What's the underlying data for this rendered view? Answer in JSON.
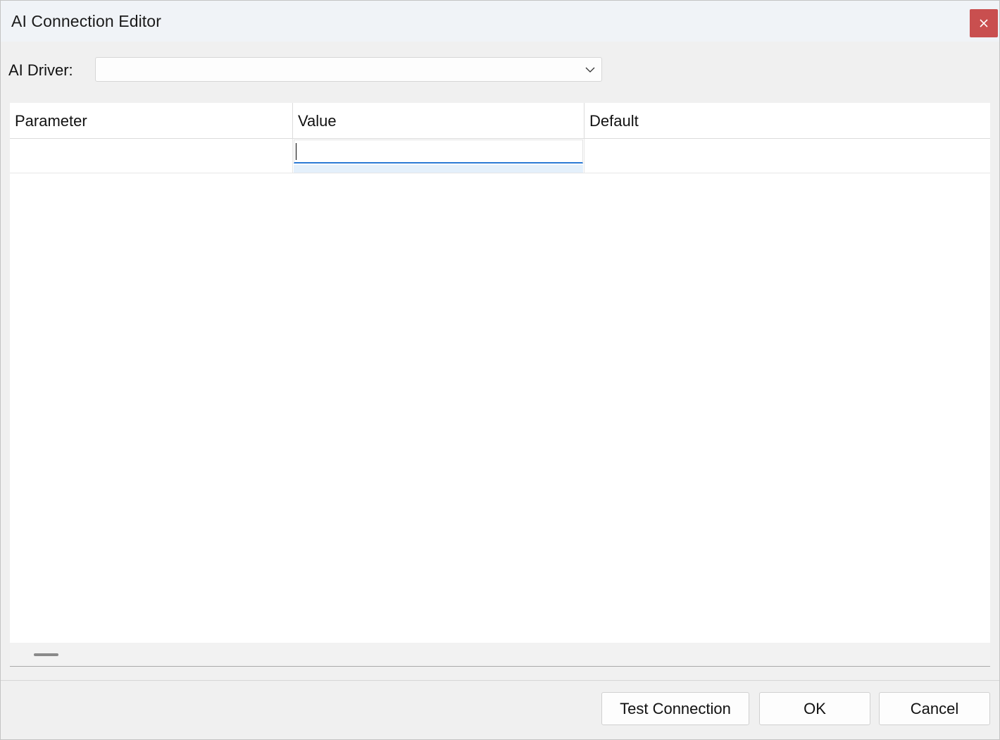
{
  "window": {
    "title": "AI Connection Editor",
    "close_icon": "close-icon",
    "close_color": "#c94f4f"
  },
  "driver": {
    "label": "AI Driver:",
    "selected_value": "",
    "dropdown_icon": "chevron-down-icon"
  },
  "grid": {
    "columns": [
      "Parameter",
      "Value",
      "Default"
    ],
    "rows": [
      {
        "parameter": "",
        "value": "",
        "default": ""
      }
    ],
    "editor_accent": "#2a7ad5"
  },
  "buttons": {
    "test_connection": "Test Connection",
    "ok": "OK",
    "cancel": "Cancel"
  }
}
